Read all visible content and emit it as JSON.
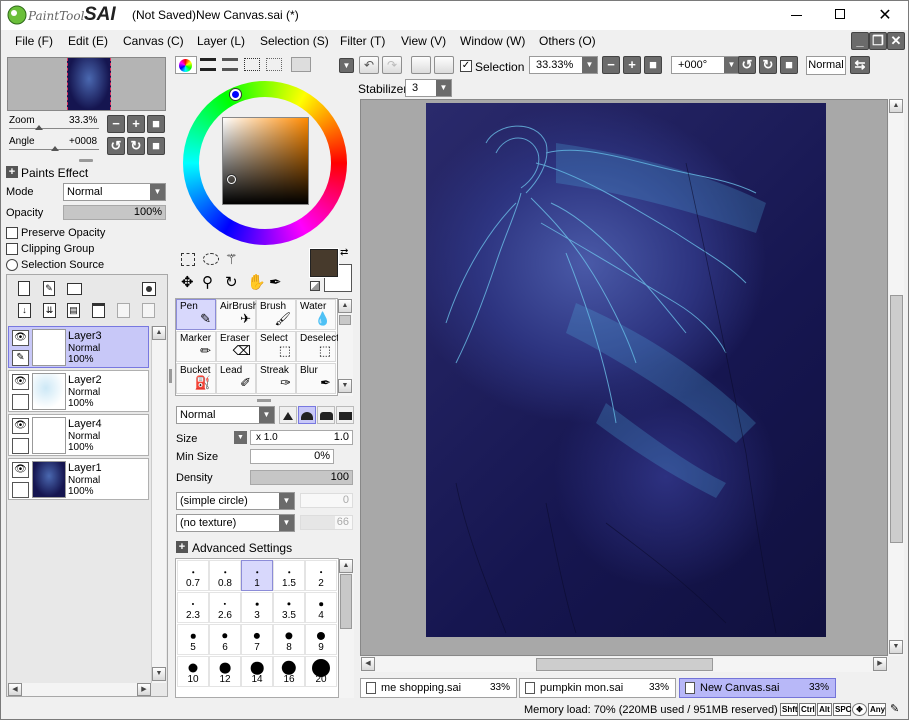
{
  "window": {
    "logo_text": "PaintTool",
    "logo_big": "SAI",
    "title": "(Not Saved)New Canvas.sai (*)"
  },
  "menu": [
    "File (F)",
    "Edit (E)",
    "Canvas (C)",
    "Layer (L)",
    "Selection (S)",
    "Filter (T)",
    "View (V)",
    "Window (W)",
    "Others (O)"
  ],
  "navigator": {
    "zoom_label": "Zoom",
    "zoom_value": "33.3%",
    "angle_label": "Angle",
    "angle_value": "+0008"
  },
  "paints_effect": {
    "header": "Paints Effect",
    "mode_label": "Mode",
    "mode_value": "Normal",
    "opacity_label": "Opacity",
    "opacity_value": "100%",
    "opacity_fraction": 1.0,
    "preserve_opacity": "Preserve Opacity",
    "clipping_group": "Clipping Group",
    "selection_source": "Selection Source"
  },
  "layers": [
    {
      "name": "Layer3",
      "mode": "Normal",
      "opacity": "100%",
      "selected": true,
      "icon": "pen-icon"
    },
    {
      "name": "Layer2",
      "mode": "Normal",
      "opacity": "100%",
      "selected": false,
      "icon": ""
    },
    {
      "name": "Layer4",
      "mode": "Normal",
      "opacity": "100%",
      "selected": false,
      "icon": ""
    },
    {
      "name": "Layer1",
      "mode": "Normal",
      "opacity": "100%",
      "selected": false,
      "icon": ""
    }
  ],
  "color": {
    "hue_marker": "#0000ff",
    "primary": "#473a2c",
    "secondary": "#ffffff"
  },
  "tools": [
    {
      "name": "Pen",
      "icon": "pen-icon",
      "selected": true
    },
    {
      "name": "AirBrush",
      "icon": "airbrush-icon",
      "selected": false
    },
    {
      "name": "Brush",
      "icon": "brush-icon",
      "selected": false
    },
    {
      "name": "Water",
      "icon": "water-icon",
      "selected": false
    },
    {
      "name": "Marker",
      "icon": "marker-icon",
      "selected": false
    },
    {
      "name": "Eraser",
      "icon": "eraser-icon",
      "selected": false
    },
    {
      "name": "Select",
      "icon": "select-icon",
      "selected": false
    },
    {
      "name": "Deselect",
      "icon": "deselect-icon",
      "selected": false
    },
    {
      "name": "Bucket",
      "icon": "bucket-icon",
      "selected": false
    },
    {
      "name": "Lead",
      "icon": "lead-icon",
      "selected": false
    },
    {
      "name": "Streak",
      "icon": "streak-icon",
      "selected": false
    },
    {
      "name": "Blur",
      "icon": "blur-icon",
      "selected": false
    }
  ],
  "brush": {
    "blend_mode": "Normal",
    "size_label": "Size",
    "size_multiplier": "x 1.0",
    "size_value": "1.0",
    "min_size_label": "Min Size",
    "min_size_value": "0%",
    "density_label": "Density",
    "density_value": "100",
    "density_fraction": 1.0,
    "shape": "(simple circle)",
    "shape_value": "0",
    "texture": "(no texture)",
    "texture_value": "66",
    "advanced_settings": "Advanced Settings",
    "sizes": [
      "0.7",
      "0.8",
      "1",
      "1.5",
      "2",
      "2.3",
      "2.6",
      "3",
      "3.5",
      "4",
      "5",
      "6",
      "7",
      "8",
      "9",
      "10",
      "12",
      "14",
      "16",
      "20"
    ],
    "selected_size": "1"
  },
  "toolbar": {
    "selection_label": "Selection",
    "zoom_value": "33.33%",
    "rotation_value": "+000°",
    "mode_value": "Normal",
    "stabilizer_label": "Stabilizer",
    "stabilizer_value": "3"
  },
  "tabs": [
    {
      "name": "me shopping.sai",
      "zoom": "33%",
      "active": false
    },
    {
      "name": "pumpkin mon.sai",
      "zoom": "33%",
      "active": false
    },
    {
      "name": "New Canvas.sai",
      "zoom": "33%",
      "active": true
    }
  ],
  "status": {
    "memory": "Memory load: 70% (220MB used / 951MB reserved)",
    "keys": [
      "Shift",
      "Ctrl",
      "Alt",
      "SPC",
      "Any"
    ]
  },
  "colors": {
    "canvas_bg": "#1c1c5a",
    "selection_highlight": "#c8c8f8",
    "workspace": "#a8a8a8"
  }
}
